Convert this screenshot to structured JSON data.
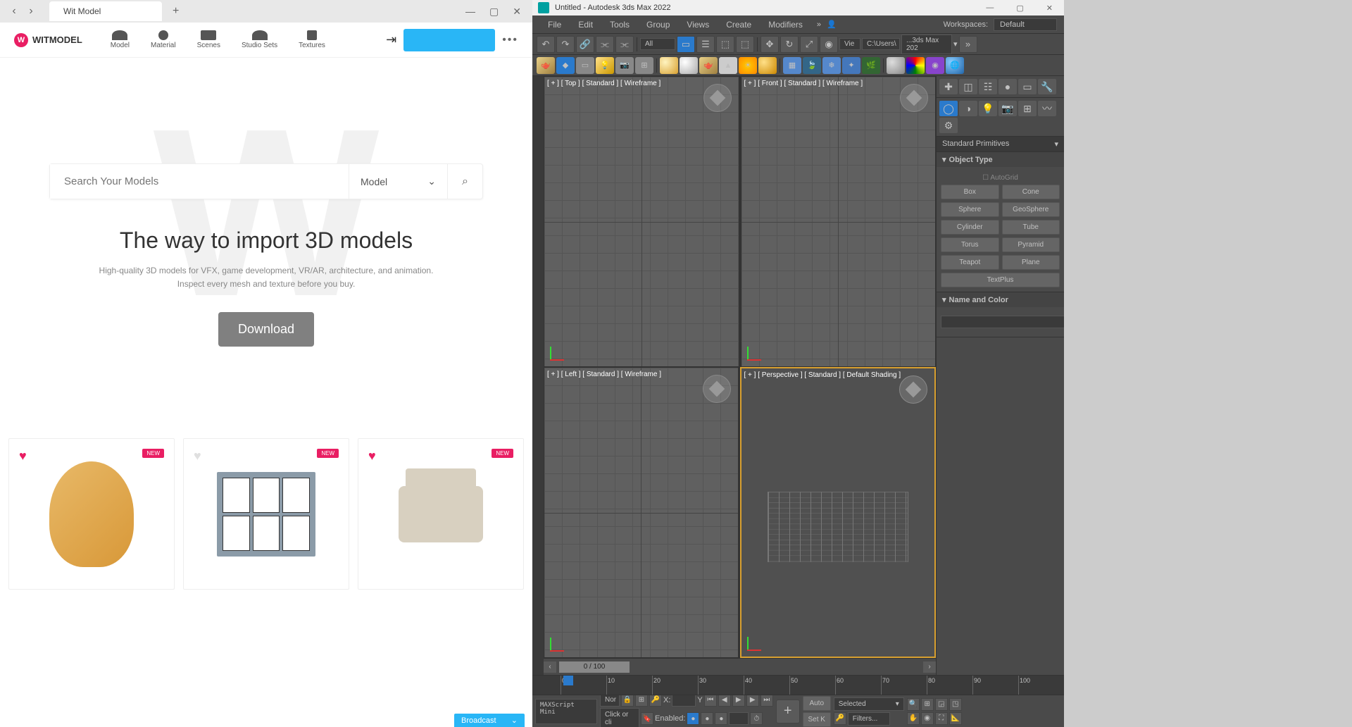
{
  "left": {
    "tab_title": "Wit Model",
    "logo": "WITMODEL",
    "nav": [
      "Model",
      "Material",
      "Scenes",
      "Studio Sets",
      "Textures"
    ],
    "search_placeholder": "Search Your Models",
    "search_type": "Model",
    "hero_title": "The way to import 3D models",
    "hero_sub1": "High-quality 3D models for VFX, game development, VR/AR, architecture, and animation.",
    "hero_sub2": "Inspect every mesh and texture before you buy.",
    "download": "Download",
    "badge": "NEW",
    "broadcast": "Broadcast"
  },
  "right": {
    "title": "Untitled - Autodesk 3ds Max 2022",
    "menus": [
      "File",
      "Edit",
      "Tools",
      "Group",
      "Views",
      "Create",
      "Modifiers"
    ],
    "workspace_label": "Workspaces:",
    "workspace_value": "Default",
    "tb_drop_all": "All",
    "tb_vie": "Vie",
    "path1": "C:\\Users\\",
    "path2": "...3ds Max 202",
    "viewports": {
      "top": "[ + ] [ Top ] [ Standard ] [ Wireframe ]",
      "front": "[ + ] [ Front ] [ Standard ] [ Wireframe ]",
      "left": "[ + ] [ Left ] [ Standard ] [ Wireframe ]",
      "persp": "[ + ] [ Perspective ] [ Standard ] [ Default Shading ]"
    },
    "timeline": "0 / 100",
    "ruler_ticks": [
      "0",
      "10",
      "20",
      "30",
      "40",
      "50",
      "60",
      "70",
      "80",
      "90",
      "100"
    ],
    "panel_drop": "Standard Primitives",
    "rollout_objtype": "Object Type",
    "autogrid": "AutoGrid",
    "obj_buttons": [
      "Box",
      "Cone",
      "Sphere",
      "GeoSphere",
      "Cylinder",
      "Tube",
      "Torus",
      "Pyramid",
      "Teapot",
      "Plane",
      "TextPlus"
    ],
    "rollout_name": "Name and Color",
    "script_label": "MAXScript Mini",
    "status_nor": "Nor",
    "status_click": "Click or cli",
    "status_enabled": "Enabled:",
    "coord_x": "X:",
    "coord_y": "Y",
    "auto_btn": "Auto",
    "setk_btn": "Set K",
    "selected_drop": "Selected",
    "filters": "Filters..."
  }
}
